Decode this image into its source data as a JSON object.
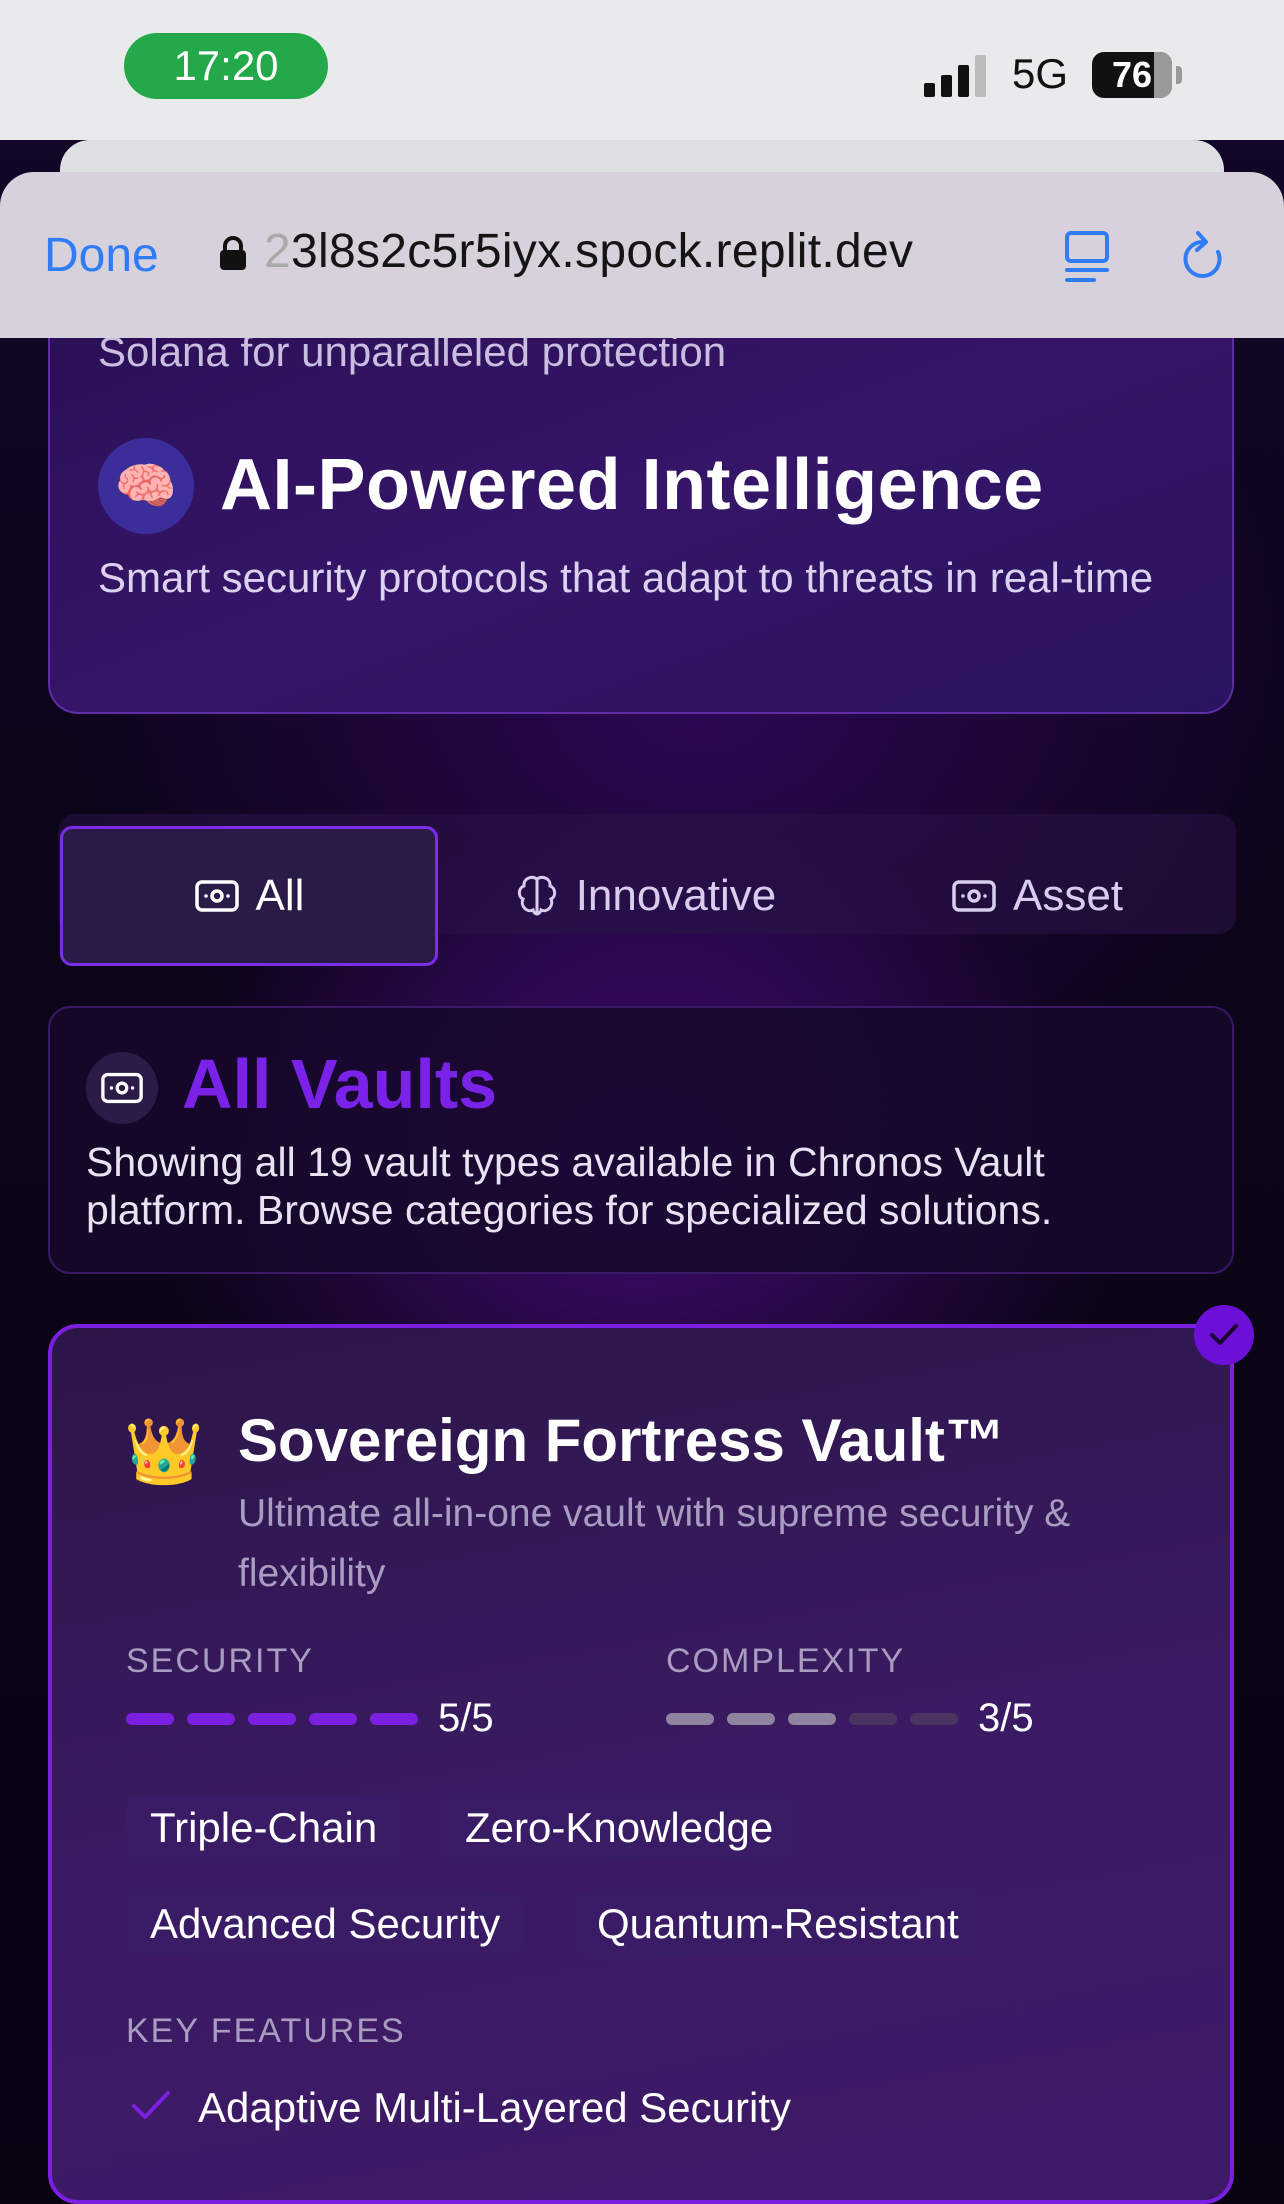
{
  "status_bar": {
    "time": "17:20",
    "network": "5G",
    "battery": "76"
  },
  "browser": {
    "done_label": "Done",
    "url_faded": "2",
    "url": "3l8s2c5r5iyx.spock.replit.dev"
  },
  "feature_card": {
    "cut_text": "Solana for unparalleled protection",
    "icon": "brain-icon",
    "title": "AI-Powered Intelligence",
    "description": "Smart security protocols that adapt to threats in real-time"
  },
  "tabs": [
    {
      "label": "All",
      "icon": "vault-icon",
      "active": true
    },
    {
      "label": "Innovative",
      "icon": "brain-icon",
      "active": false
    },
    {
      "label": "Asset",
      "icon": "vault-icon",
      "active": false
    }
  ],
  "info": {
    "title": "All Vaults",
    "description": "Showing all 19 vault types available in Chronos Vault platform. Browse categories for specialized solutions."
  },
  "vault": {
    "icon": "crown-icon",
    "title": "Sovereign Fortress Vault™",
    "description": "Ultimate all-in-one vault with supreme security & flexibility",
    "security_label": "SECURITY",
    "security_value": "5/5",
    "security_level": 5,
    "complexity_label": "COMPLEXITY",
    "complexity_value": "3/5",
    "complexity_level": 3,
    "tags": [
      "Triple-Chain",
      "Zero-Knowledge",
      "Advanced Security",
      "Quantum-Resistant"
    ],
    "key_features_label": "KEY FEATURES",
    "features": [
      "Adaptive Multi-Layered Security"
    ]
  },
  "colors": {
    "accent": "#7b1fe0",
    "link_blue": "#2f7cf6",
    "time_pill": "#23a84a"
  }
}
